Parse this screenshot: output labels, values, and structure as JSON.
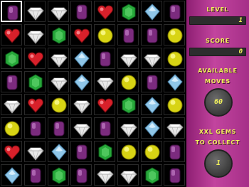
{
  "panel": {
    "level_label": "LEVEL",
    "level_value": "1",
    "score_label": "SCORE",
    "score_value": "0",
    "moves_label_1": "AVAILABLE",
    "moves_label_2": "MOVES",
    "moves_value": "60",
    "gems_label_1": "XXL GEMS",
    "gems_label_2": "TO COLLECT",
    "gems_value": "1"
  },
  "board": {
    "selected": [
      0,
      0
    ],
    "rows": [
      [
        "purple",
        "diamond",
        "diamond",
        "purple",
        "heart",
        "green",
        "blue",
        "purple"
      ],
      [
        "heart",
        "diamond",
        "green",
        "heart",
        "yellow",
        "purple",
        "purple",
        "yellow"
      ],
      [
        "green",
        "heart",
        "diamond",
        "blue",
        "purple",
        "diamond",
        "diamond",
        "yellow"
      ],
      [
        "purple",
        "green",
        "diamond",
        "blue",
        "diamond",
        "yellow",
        "purple",
        "blue"
      ],
      [
        "diamond",
        "heart",
        "yellow",
        "diamond",
        "heart",
        "green",
        "blue",
        "yellow"
      ],
      [
        "yellow",
        "purple",
        "purple",
        "diamond",
        "purple",
        "diamond",
        "blue",
        "diamond"
      ],
      [
        "heart",
        "diamond",
        "blue",
        "purple",
        "green",
        "yellow",
        "yellow",
        "purple"
      ],
      [
        "blue",
        "purple",
        "green",
        "purple",
        "diamond",
        "diamond",
        "green",
        "purple"
      ]
    ]
  },
  "colors": {
    "purple": "#7b2b7e",
    "green": "#27a83a",
    "blue": "#8fc6e8",
    "yellow": "#d8d414",
    "heart": "#d8202a",
    "diamond": "#e8e8e8",
    "panel": "#b23a92",
    "label": "#f2f25a"
  }
}
